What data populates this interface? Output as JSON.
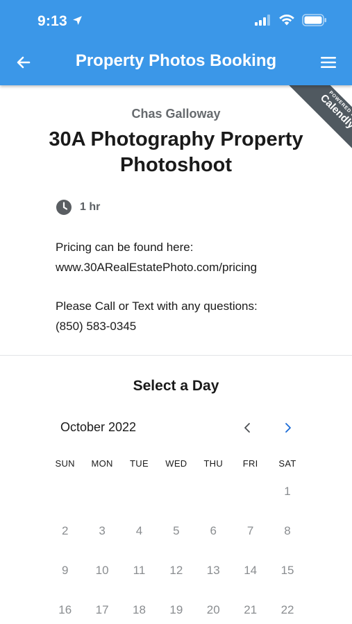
{
  "status_bar": {
    "time": "9:13",
    "signal_icon": "signal-bars-icon",
    "wifi_icon": "wifi-icon",
    "battery_icon": "battery-icon"
  },
  "app_bar": {
    "title": "Property Photos Booking",
    "back_icon": "arrow-left-icon",
    "menu_icon": "hamburger-menu-icon",
    "color": "#3b97e8"
  },
  "ribbon": {
    "top_text": "POWERED BY",
    "brand": "Calendly"
  },
  "event": {
    "host": "Chas Galloway",
    "title": "30A Photography Property Photoshoot",
    "duration": "1 hr",
    "clock_icon": "clock-icon",
    "pricing_line1": "Pricing can be found here:",
    "pricing_line2": "www.30ARealEstatePhoto.com/pricing",
    "contact_line1": "Please Call or Text with any questions:",
    "contact_line2": "(850) 583-0345"
  },
  "calendar": {
    "heading": "Select a Day",
    "month_label": "October 2022",
    "prev_icon": "chevron-left-icon",
    "next_icon": "chevron-right-icon",
    "accent": "#1a6bd6",
    "weekdays": [
      "SUN",
      "MON",
      "TUE",
      "WED",
      "THU",
      "FRI",
      "SAT"
    ],
    "days": [
      "",
      "",
      "",
      "",
      "",
      "",
      "1",
      "2",
      "3",
      "4",
      "5",
      "6",
      "7",
      "8",
      "9",
      "10",
      "11",
      "12",
      "13",
      "14",
      "15",
      "16",
      "17",
      "18",
      "19",
      "20",
      "21",
      "22"
    ]
  }
}
